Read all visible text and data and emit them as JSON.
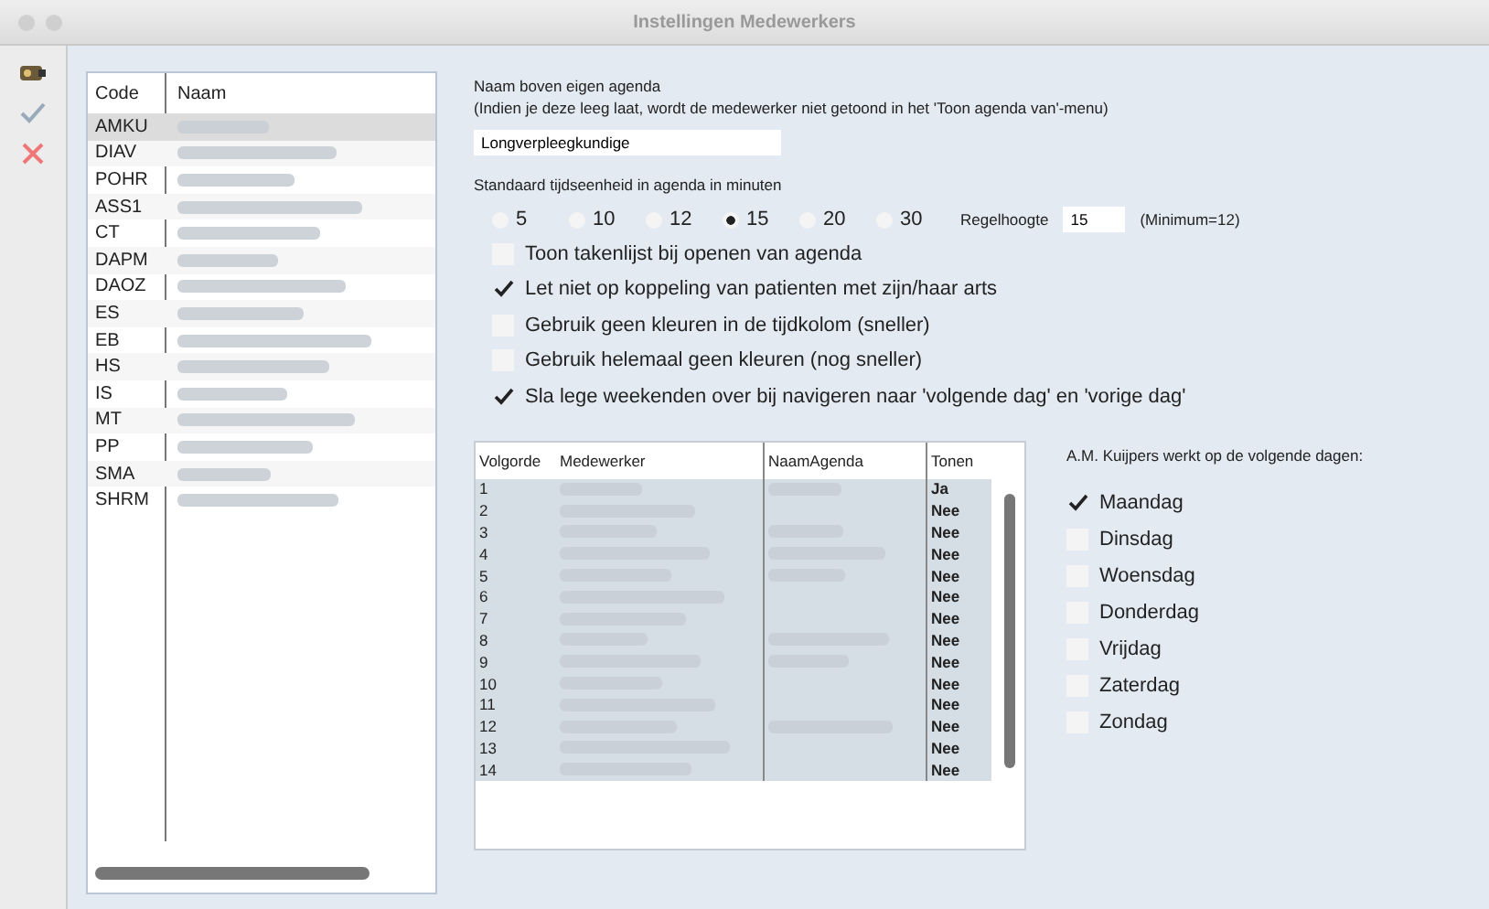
{
  "window": {
    "title": "Instellingen Medewerkers"
  },
  "toolbar": [
    {
      "kind": "key"
    },
    {
      "kind": "check"
    },
    {
      "kind": "cross"
    }
  ],
  "employee_list": {
    "columns": [
      "Code",
      "Naam"
    ],
    "rows": [
      {
        "code": "AMKU",
        "selected": true
      },
      {
        "code": "DIAV",
        "selected": false
      },
      {
        "code": "POHR",
        "selected": false
      },
      {
        "code": "ASS1",
        "selected": false
      },
      {
        "code": "CT",
        "selected": false
      },
      {
        "code": "DAPM",
        "selected": false
      },
      {
        "code": "DAOZ",
        "selected": false
      },
      {
        "code": "ES",
        "selected": false
      },
      {
        "code": "EB",
        "selected": false
      },
      {
        "code": "HS",
        "selected": false
      },
      {
        "code": "IS",
        "selected": false
      },
      {
        "code": "MT",
        "selected": false
      },
      {
        "code": "PP",
        "selected": false
      },
      {
        "code": "SMA",
        "selected": false
      },
      {
        "code": "SHRM",
        "selected": false
      }
    ]
  },
  "agenda_name": {
    "label": "Naam boven eigen agenda",
    "hint": "(Indien je deze leeg laat, wordt de medewerker niet getoond in het 'Toon agenda van'-menu)",
    "value": "Longverpleegkundige"
  },
  "time_unit": {
    "label": "Standaard tijdseenheid in agenda in minuten",
    "options": [
      {
        "label": "5",
        "selected": false
      },
      {
        "label": "10",
        "selected": false
      },
      {
        "label": "12",
        "selected": false
      },
      {
        "label": "15",
        "selected": true
      },
      {
        "label": "20",
        "selected": false
      },
      {
        "label": "30",
        "selected": false
      }
    ],
    "row_height_label": "Regelhoogte",
    "row_height_value": "15",
    "row_height_note": "(Minimum=12)"
  },
  "options": [
    {
      "label": "Toon takenlijst bij openen van agenda",
      "checked": false
    },
    {
      "label": "Let niet op koppeling van patienten met zijn/haar  arts",
      "checked": true
    },
    {
      "label": "Gebruik geen kleuren in de tijdkolom (sneller)",
      "checked": false
    },
    {
      "label": "Gebruik helemaal geen kleuren (nog sneller)",
      "checked": false
    },
    {
      "label": "Sla lege weekenden over bij navigeren naar 'volgende dag' en 'vorige dag'",
      "checked": true
    }
  ],
  "order_table": {
    "columns": [
      "Volgorde",
      "Medewerker",
      "NaamAgenda",
      "Tonen"
    ],
    "rows": [
      {
        "order": "1",
        "agenda_filled": true,
        "show": "Ja"
      },
      {
        "order": "2",
        "agenda_filled": false,
        "show": "Nee"
      },
      {
        "order": "3",
        "agenda_filled": true,
        "show": "Nee"
      },
      {
        "order": "4",
        "agenda_filled": true,
        "show": "Nee"
      },
      {
        "order": "5",
        "agenda_filled": true,
        "show": "Nee"
      },
      {
        "order": "6",
        "agenda_filled": false,
        "show": "Nee"
      },
      {
        "order": "7",
        "agenda_filled": false,
        "show": "Nee"
      },
      {
        "order": "8",
        "agenda_filled": true,
        "show": "Nee"
      },
      {
        "order": "9",
        "agenda_filled": true,
        "show": "Nee"
      },
      {
        "order": "10",
        "agenda_filled": false,
        "show": "Nee"
      },
      {
        "order": "11",
        "agenda_filled": false,
        "show": "Nee"
      },
      {
        "order": "12",
        "agenda_filled": true,
        "show": "Nee"
      },
      {
        "order": "13",
        "agenda_filled": false,
        "show": "Nee"
      },
      {
        "order": "14",
        "agenda_filled": false,
        "show": "Nee"
      }
    ]
  },
  "workdays": {
    "label": "A.M. Kuijpers werkt op de volgende dagen:",
    "days": [
      {
        "label": "Maandag",
        "checked": true
      },
      {
        "label": "Dinsdag",
        "checked": false
      },
      {
        "label": "Woensdag",
        "checked": false
      },
      {
        "label": "Donderdag",
        "checked": false
      },
      {
        "label": "Vrijdag",
        "checked": false
      },
      {
        "label": "Zaterdag",
        "checked": false
      },
      {
        "label": "Zondag",
        "checked": false
      }
    ]
  }
}
